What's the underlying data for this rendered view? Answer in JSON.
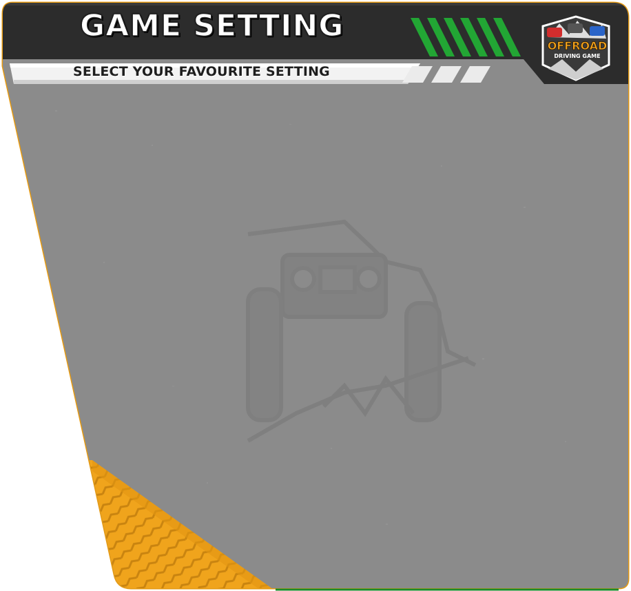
{
  "header": {
    "title": "GAME SETTING",
    "subtitle": "SELECT YOUR FAVOURITE SETTING"
  },
  "logo": {
    "line1": "OFFROAD",
    "line2": "DRIVING GAME"
  },
  "colors": {
    "panel_gray": "#8a8a8a",
    "header_dark": "#2b2b2b",
    "accent_orange": "#f0a41c",
    "accent_green": "#1fa82f",
    "border_orange": "#f0a41c"
  },
  "icons": {
    "background_art": "offroad-jeep-watermark-icon",
    "corner_art": "tire-track-icon"
  }
}
